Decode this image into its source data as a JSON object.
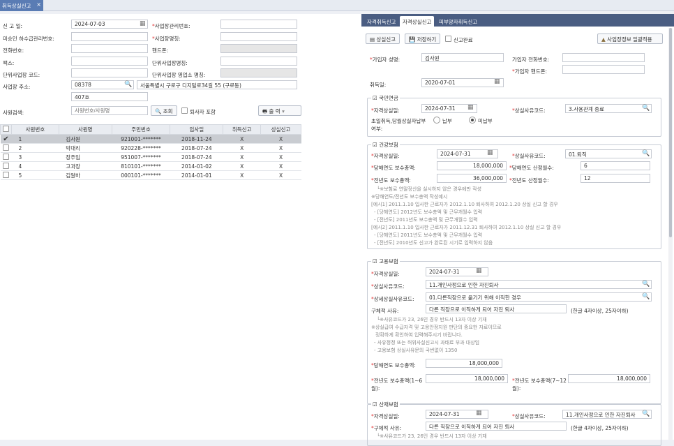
{
  "top_tab": {
    "label": "취득상실신고",
    "close": "×"
  },
  "left_form": {
    "report_date_label": "신 고 일:",
    "report_date": "2024-07-03",
    "biz_mgmt_no_label": "*사업장관리번호:",
    "biz_mgmt_no": "",
    "wage_unpaid_no_label": "미승인 하수급관리번호:",
    "wage_unpaid_no": "",
    "biz_name_label": "*사업장명칭:",
    "biz_name": "",
    "phone_label": "전화번호:",
    "phone": "",
    "mobile_label": "핸드폰:",
    "mobile": "",
    "fax_label": "팩스:",
    "fax": "",
    "unit_biz_name_label": "단위사업장명칭:",
    "unit_biz_name": "",
    "unit_biz_code_label": "단위사업장 코드:",
    "unit_biz_code": "",
    "unit_biz_office_label": "단위사업장 영업소 명칭:",
    "unit_biz_office": "",
    "address_label": "사업장 주소:",
    "zip": "08378",
    "address1": "서울특별시 구로구 디지털로34길 55 (구로동)",
    "address2": "407호",
    "search_label": "사원검색:",
    "search_placeholder": "사원번호/사원명",
    "search_button": "조회",
    "retired_label": "퇴사자 포함",
    "print_button": "출 력"
  },
  "grid": {
    "headers": [
      "사원번호",
      "사원명",
      "주민번호",
      "입사일",
      "취득신고",
      "상실신고"
    ],
    "rows": [
      {
        "no": "1",
        "name": "김사원",
        "rrn": "921001-*******",
        "join": "2018-11-24",
        "acq": "X",
        "loss": "X",
        "checked": true
      },
      {
        "no": "2",
        "name": "박대리",
        "rrn": "920228-*******",
        "join": "2018-07-24",
        "acq": "X",
        "loss": "X",
        "checked": false
      },
      {
        "no": "3",
        "name": "장주임",
        "rrn": "951007-*******",
        "join": "2018-07-24",
        "acq": "X",
        "loss": "X",
        "checked": false
      },
      {
        "no": "4",
        "name": "고과장",
        "rrn": "810101-*******",
        "join": "2014-01-02",
        "acq": "X",
        "loss": "X",
        "checked": false
      },
      {
        "no": "5",
        "name": "김알바",
        "rrn": "000101-*******",
        "join": "2014-01-01",
        "acq": "X",
        "loss": "X",
        "checked": false
      }
    ]
  },
  "right": {
    "tabs": [
      "자격취득신고",
      "자격상실신고",
      "피부양자취득신고"
    ],
    "toolbar": {
      "loss_report": "상실신고",
      "save": "저장하기",
      "done": "신고완료",
      "apply_all": "사업장정보 일괄적용"
    },
    "subscriber_name_label": "*가입자 성명:",
    "subscriber_name": "김사원",
    "subscriber_phone_label": "가입자 전화번호:",
    "subscriber_phone": "",
    "subscriber_mobile_label": "*가입자 핸드폰:",
    "subscriber_mobile": "",
    "acq_date_label": "취득일:",
    "acq_date": "2020-07-01",
    "pension": {
      "title": "국민연금",
      "loss_date_label": "*자격상실일:",
      "loss_date": "2024-07-31",
      "reason_label": "*상실사유코드:",
      "reason": "3.사용관계 종료",
      "first_month_label": "초일취득,당월상실자납부",
      "first_month_label2": "여부:",
      "pay": "납부",
      "nopay": "미납부"
    },
    "health": {
      "title": "건강보험",
      "loss_date_label": "*자격상실일:",
      "loss_date": "2024-07-31",
      "reason_label": "*상실사유코드:",
      "reason": "01.퇴직",
      "cur_total_label": "*당해연도 보수총액:",
      "cur_total": "18,000,000",
      "cur_months_label": "*당해연도 산정월수:",
      "cur_months": "6",
      "prev_total_label": "*전년도 보수총액:",
      "prev_total": "36,000,000",
      "prev_months_label": "*전년도 산정월수:",
      "prev_months": "12",
      "notes": [
        "└※보험료 연말정산을 실시하지 않은 경우에만 작성",
        "※당해연도/전년도 보수총액 작성예시",
        "[예시1] 2011.1.10 입사한 근로자가 2012.1.10 퇴사하여 2012.1.20 상실 신고 할 경우",
        "- [당해연도] 2012년도 보수총액 및 근무개월수 입력",
        "- [전년도] 2011년도 보수총액 및 근무개월수 입력",
        "[예시2] 2011.1.10 입사한 근로자가 2011.12.31 퇴사하여 2012.1.10 상실 신고 할 경우",
        "- [당해연도] 2011년도 보수총액 및 근무개월수 입력",
        "- [전년도] 2010년도 신고가 완료된 시기로 입력하지 않음"
      ]
    },
    "employment": {
      "title": "고용보험",
      "loss_date_label": "*자격상실일:",
      "loss_date": "2024-07-31",
      "reason_label": "*상실사유코드:",
      "reason": "11.개인사정으로 인한 자진퇴사",
      "detail_label": "*상세상실사유코드:",
      "detail": "01.다른직장으로 옮기기 위해 이직한 경우",
      "specific_label": "구체적 사유:",
      "specific": "다른 직장으로 이직하게 되어 자진 퇴사",
      "specific_hint": "(한글 4자이상, 25자이하)",
      "notes": [
        "└※사유코드가 23, 26인 경우 반드시 13자 이상 기재",
        "※상실급여 수급자격 및 고용안정지원 판단의 중요한 자료이므로",
        "정확하게 확인하여 입력해주시기 바랍니다.",
        "- 사유정정 또는 허위사실신고시 과태료 부과 대상임",
        "- 고용보험 상실사유문의 국번없이 1350"
      ],
      "cur_total_label": "*당해연도 보수총액:",
      "cur_total": "18,000,000",
      "prev_total1_label": "*전년도 보수총액(1~6",
      "prev_total1_label2": "월):",
      "prev_total1": "18,000,000",
      "prev_total2_label": "*전년도 보수총액(7~12",
      "prev_total2_label2": "월):",
      "prev_total2": "18,000,000"
    },
    "industrial": {
      "title": "산재보험",
      "loss_date_label": "*자격상실일:",
      "loss_date": "2024-07-31",
      "reason_label": "*상실사유코드:",
      "reason": "11.개인사정으로 인한 자진퇴사",
      "specific_label": "*구체적 사유:",
      "specific": "다른 직장으로 이직하게 되어 자진 퇴사",
      "specific_hint": "(한글 4자이상, 25자이하)",
      "note": "└※사유코드가 23, 26인 경우 반드시 13자 이상 기재"
    }
  }
}
